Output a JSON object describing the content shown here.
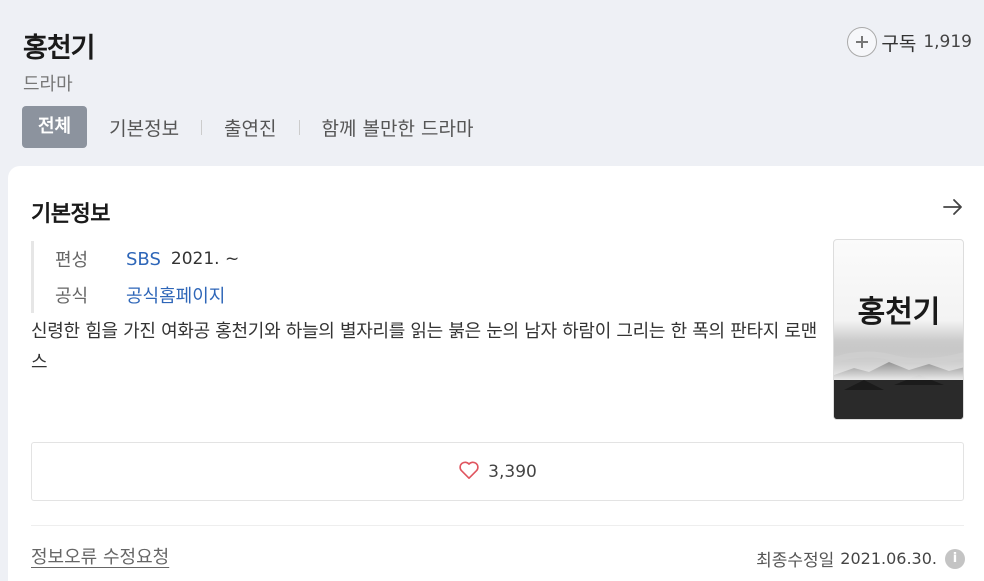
{
  "header": {
    "title": "홍천기",
    "subtitle": "드라마",
    "subscribe_label": "구독",
    "subscribe_count": "1,919"
  },
  "tabs": [
    {
      "label": "전체",
      "active": true
    },
    {
      "label": "기본정보"
    },
    {
      "label": "출연진"
    },
    {
      "label": "함께 볼만한 드라마"
    }
  ],
  "card": {
    "title": "기본정보",
    "info": {
      "broadcast_label": "편성",
      "broadcast_channel": "SBS",
      "broadcast_date": "2021. ~",
      "official_label": "공식",
      "official_link": "공식홈페이지"
    },
    "description": "신령한 힘을 가진 여화공 홍천기와 하늘의 별자리를 읽는 붉은 눈의 남자 하람이 그리는 한 폭의 판타지 로맨스",
    "poster_text": "홍천기",
    "likes": "3,390",
    "report_link": "정보오류 수정요청",
    "updated_label": "최종수정일",
    "updated_date": "2021.06.30."
  },
  "colors": {
    "accent_tab": "#8c939e",
    "link": "#2e66b8",
    "heart": "#e0555f",
    "background": "#eef0f5"
  },
  "icons": [
    "plus-icon",
    "arrow-right-icon",
    "heart-icon",
    "info-icon"
  ]
}
